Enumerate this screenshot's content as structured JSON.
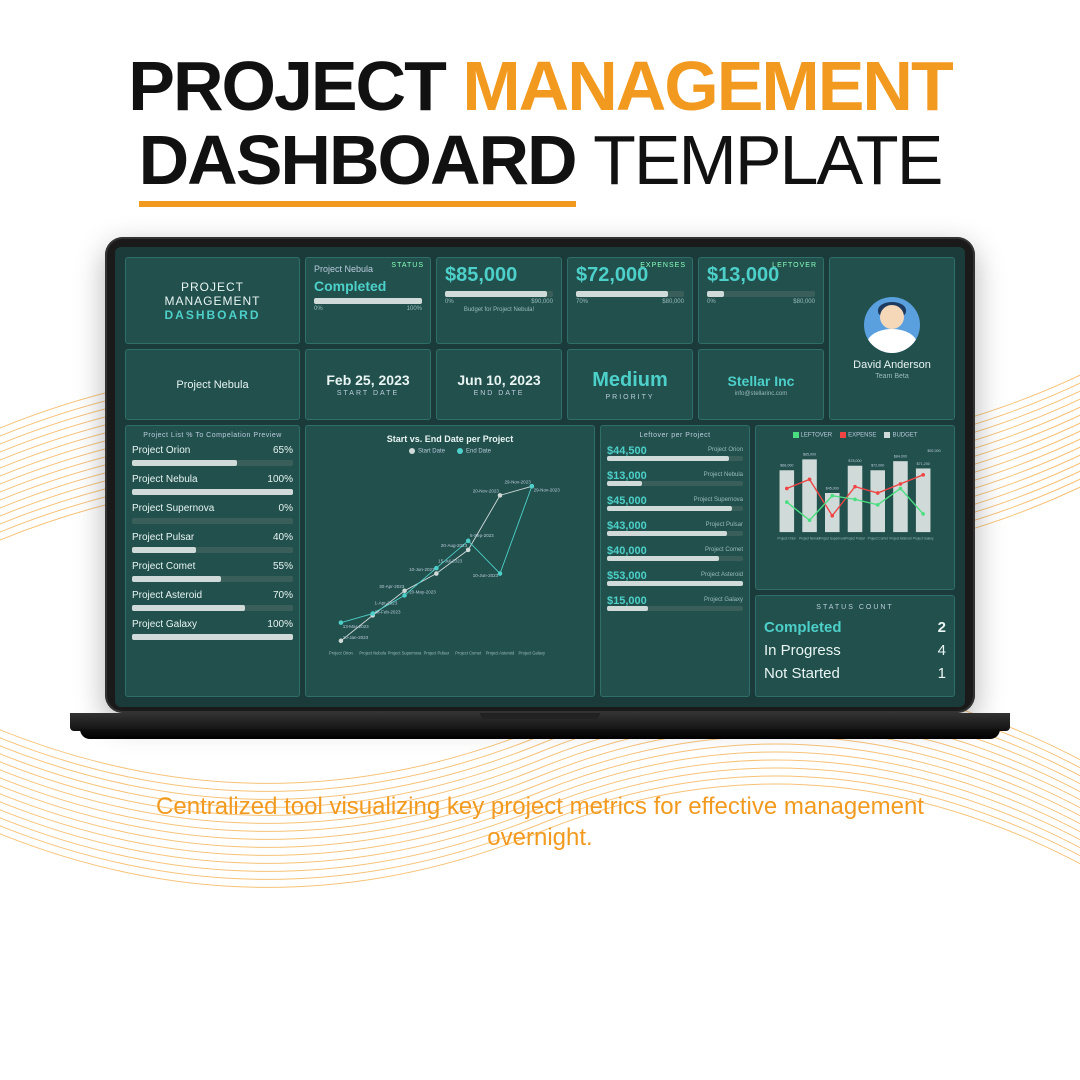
{
  "hero": {
    "w1": "PROJECT",
    "w2": "MANAGEMENT",
    "w3": "DASHBOARD",
    "w4": "TEMPLATE"
  },
  "tagline": "Centralized tool visualizing key project metrics for effective management overnight.",
  "brand": {
    "l1": "PROJECT",
    "l2": "MANAGEMENT",
    "l3": "DASHBOARD"
  },
  "selected": "Project Nebula",
  "status": {
    "project": "Project Nebula",
    "label": "STATUS",
    "value": "Completed",
    "pct": 100,
    "lo": "0%",
    "hi": "100%"
  },
  "kpi": {
    "budget": {
      "val": "$85,000",
      "cap": "Budget for Project Nebula!",
      "hdr": "",
      "lo": "0%",
      "hi": "$90,000",
      "pct": 94
    },
    "expense": {
      "val": "$72,000",
      "hdr": "EXPENSES",
      "lo": "70%",
      "hi": "$80,000",
      "pct": 85
    },
    "leftover": {
      "val": "$13,000",
      "hdr": "LEFTOVER",
      "lo": "0%",
      "hi": "$80,000",
      "pct": 16
    }
  },
  "dates": {
    "start": {
      "v": "Feb 25, 2023",
      "l": "START DATE"
    },
    "end": {
      "v": "Jun 10, 2023",
      "l": "END DATE"
    }
  },
  "priority": {
    "v": "Medium",
    "l": "PRIORITY"
  },
  "client": {
    "name": "Stellar Inc",
    "email": "info@stellarinc.com"
  },
  "user": {
    "name": "David Anderson",
    "team": "Team Beta"
  },
  "plist": {
    "title": "Project List % To Compelation Preview",
    "items": [
      {
        "n": "Project Orion",
        "p": 65
      },
      {
        "n": "Project Nebula",
        "p": 100
      },
      {
        "n": "Project Supernova",
        "p": 0
      },
      {
        "n": "Project Pulsar",
        "p": 40
      },
      {
        "n": "Project Comet",
        "p": 55
      },
      {
        "n": "Project Asteroid",
        "p": 70
      },
      {
        "n": "Project Galaxy",
        "p": 100
      }
    ]
  },
  "timeline": {
    "title": "Start vs. End Date per Project",
    "legend": {
      "s": "Start Date",
      "e": "End Date"
    },
    "labels": [
      "10-Jan-2023",
      "28-Feb-2023",
      "30-Apr-2023",
      "10-Jun-2023",
      "20-Aug-2023",
      "20-Nov-2023",
      "29-Nov-2023",
      "13-Mar-2023",
      "1-Apr-2023",
      "20-May-2023",
      "15-Jul-2023",
      "5-Sep-2023",
      "10-Jun-2023",
      "29-Nov-2023"
    ],
    "cats": [
      "Project Orion",
      "Project Nebula",
      "Project Supernova",
      "Project Pulsar",
      "Project Comet",
      "Project Asteroid",
      "Project Galaxy"
    ]
  },
  "leftover": {
    "title": "Leftover per Project",
    "items": [
      {
        "v": "$44,500",
        "n": "Project Orion",
        "p": 90
      },
      {
        "v": "$13,000",
        "n": "Project Nebula",
        "p": 26
      },
      {
        "v": "$45,000",
        "n": "Project Supernova",
        "p": 92
      },
      {
        "v": "$43,000",
        "n": "Project Pulsar",
        "p": 88
      },
      {
        "v": "$40,000",
        "n": "Project Comet",
        "p": 82
      },
      {
        "v": "$53,000",
        "n": "Project Asteroid",
        "p": 100
      },
      {
        "v": "$15,000",
        "n": "Project Galaxy",
        "p": 30
      }
    ]
  },
  "barchart": {
    "legend": {
      "l": "LEFTOVER",
      "e": "EXPENSE",
      "b": "BUDGET"
    },
    "tops": [
      "$68,000",
      "$85,000",
      "$45,000",
      "$78,000",
      "$72,000",
      "$84,000",
      "$71,200",
      "$92,000"
    ],
    "cats": [
      "Project Orion",
      "Project Nebula",
      "Project Supernova",
      "Project Pulsar",
      "Project Comet",
      "Project Asteroid",
      "Project Galaxy"
    ]
  },
  "scount": {
    "title": "STATUS COUNT",
    "items": [
      {
        "l": "Completed",
        "v": 2,
        "c": "comp"
      },
      {
        "l": "In Progress",
        "v": 4,
        "c": ""
      },
      {
        "l": "Not Started",
        "v": 1,
        "c": ""
      }
    ]
  },
  "chart_data": [
    {
      "type": "bar",
      "title": "Project List % To Compelation Preview",
      "categories": [
        "Project Orion",
        "Project Nebula",
        "Project Supernova",
        "Project Pulsar",
        "Project Comet",
        "Project Asteroid",
        "Project Galaxy"
      ],
      "values": [
        65,
        100,
        0,
        40,
        55,
        70,
        100
      ],
      "ylim": [
        0,
        100
      ]
    },
    {
      "type": "line",
      "title": "Start vs. End Date per Project",
      "categories": [
        "Project Orion",
        "Project Nebula",
        "Project Supernova",
        "Project Pulsar",
        "Project Comet",
        "Project Asteroid",
        "Project Galaxy"
      ],
      "series": [
        {
          "name": "Start Date",
          "values": [
            "10-Jan-2023",
            "28-Feb-2023",
            "30-Apr-2023",
            "10-Jun-2023",
            "20-Aug-2023",
            "20-Nov-2023",
            "29-Nov-2023"
          ]
        },
        {
          "name": "End Date",
          "values": [
            "13-Mar-2023",
            "1-Apr-2023",
            "20-May-2023",
            "15-Jul-2023",
            "5-Sep-2023",
            "10-Jun-2023",
            "29-Nov-2023"
          ]
        }
      ]
    },
    {
      "type": "bar",
      "title": "Leftover per Project",
      "categories": [
        "Project Orion",
        "Project Nebula",
        "Project Supernova",
        "Project Pulsar",
        "Project Comet",
        "Project Asteroid",
        "Project Galaxy"
      ],
      "values": [
        44500,
        13000,
        45000,
        43000,
        40000,
        53000,
        15000
      ]
    },
    {
      "type": "bar",
      "title": "Leftover / Expense / Budget",
      "categories": [
        "Project Orion",
        "Project Nebula",
        "Project Supernova",
        "Project Pulsar",
        "Project Comet",
        "Project Asteroid",
        "Project Galaxy"
      ],
      "series": [
        {
          "name": "BUDGET",
          "values": [
            68000,
            85000,
            45000,
            78000,
            72000,
            84000,
            71200
          ]
        },
        {
          "name": "EXPENSE",
          "values": [
            23500,
            72000,
            0,
            35000,
            32000,
            31000,
            56200
          ]
        },
        {
          "name": "LEFTOVER",
          "values": [
            44500,
            13000,
            45000,
            43000,
            40000,
            53000,
            15000
          ]
        }
      ]
    },
    {
      "type": "table",
      "title": "STATUS COUNT",
      "categories": [
        "Completed",
        "In Progress",
        "Not Started"
      ],
      "values": [
        2,
        4,
        1
      ]
    }
  ]
}
